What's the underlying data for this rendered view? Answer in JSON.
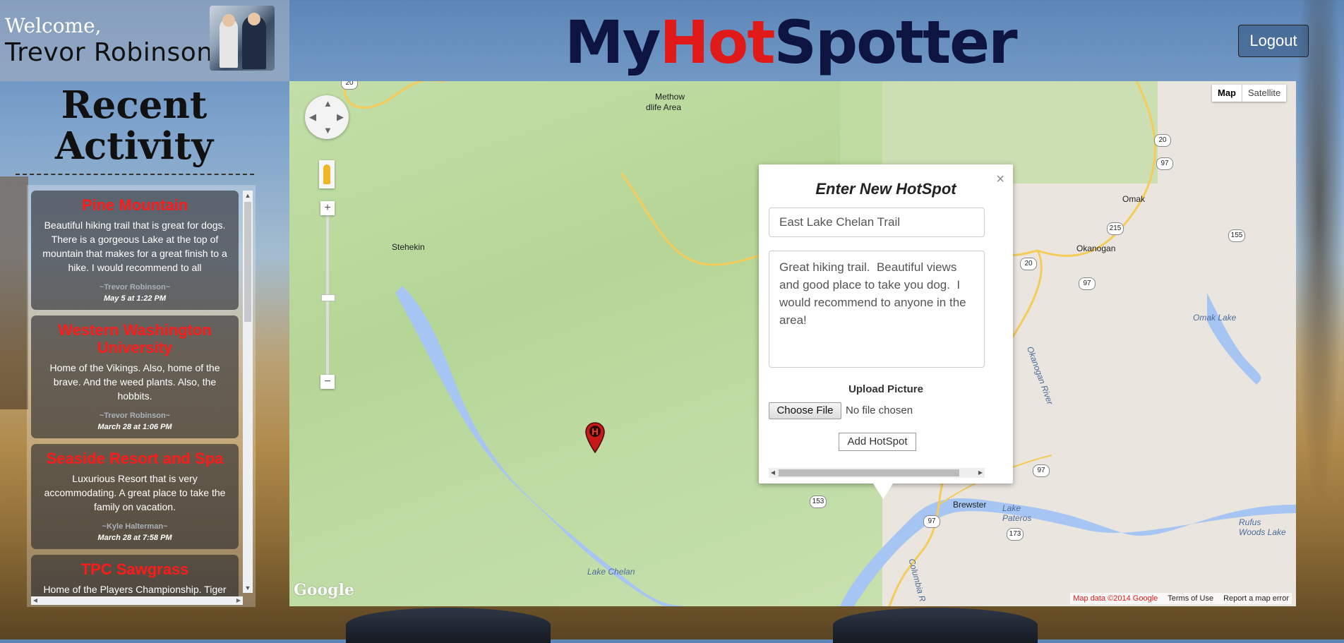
{
  "header": {
    "welcome": "Welcome,",
    "user_name": "Trevor Robinson",
    "brand_my": "My",
    "brand_hot": "Hot",
    "brand_spotter": "Spotter",
    "logout": "Logout",
    "colors": {
      "brand_dark": "#0d1440",
      "brand_hot": "#e01919"
    }
  },
  "sidebar": {
    "title_line1": "Recent",
    "title_line2": "Activity",
    "posts": [
      {
        "title": "Pine Mountain",
        "body": "Beautiful hiking trail that is great for dogs. There is a gorgeous Lake at the top of mountain that makes for a great finish to a hike. I would recommend to all",
        "author": "~Trevor Robinson~",
        "date": "May 5 at 1:22 PM"
      },
      {
        "title": "Western Washington University",
        "body": "Home of the Vikings. Also, home of the brave. And the weed plants. Also, the hobbits.",
        "author": "~Trevor Robinson~",
        "date": "March 28 at 1:06 PM"
      },
      {
        "title": "Seaside Resort and Spa",
        "body": "Luxurious Resort that is very accommodating. A great place to take the family on vacation.",
        "author": "~Kyle Halterman~",
        "date": "March 28 at 7:58 PM"
      },
      {
        "title": "TPC Sawgrass",
        "body": "Home of the Players Championship. Tiger",
        "author": "",
        "date": ""
      }
    ]
  },
  "map": {
    "type_buttons": [
      "Map",
      "Satellite"
    ],
    "labels": {
      "stehekin": "Stehekin",
      "methow": "Methow",
      "wildlife": "dlife Area",
      "omak": "Omak",
      "okanogan": "Okanogan",
      "brewster": "Brewster",
      "lake_chelan": "Lake Chelan",
      "omak_lake": "Omak Lake",
      "lake_pateros": "Lake\nPateros",
      "rufus": "Rufus\nWoods Lake",
      "okanogan_river": "Okanogan River",
      "columbia": "Columbia R"
    },
    "shields": [
      "20",
      "20",
      "20",
      "20",
      "97",
      "97",
      "97",
      "97",
      "215",
      "155",
      "153",
      "153",
      "173",
      "20"
    ],
    "google": "Google",
    "footer": {
      "map_data": "Map data ©2014 Google",
      "terms": "Terms of Use",
      "report": "Report a map error"
    },
    "marker_letter": "H"
  },
  "popup": {
    "title": "Enter New HotSpot",
    "name_value": "East Lake Chelan Trail",
    "desc_value": "Great hiking trail.  Beautiful views and good place to take you dog.  I would recommend to anyone in the area!",
    "upload_label": "Upload Picture",
    "choose_file": "Choose File",
    "no_file": "No file chosen",
    "add_button": "Add HotSpot",
    "close": "×"
  }
}
